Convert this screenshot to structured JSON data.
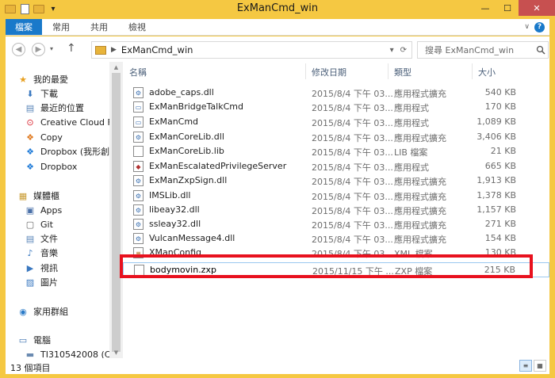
{
  "window": {
    "title": "ExManCmd_win",
    "min_label": "—",
    "max_label": "☐",
    "close_label": "✕"
  },
  "ribbon": {
    "tabs": [
      "檔案",
      "常用",
      "共用",
      "檢視"
    ]
  },
  "address": {
    "back_label": "◀",
    "forward_label": "▶",
    "up_label": "↑",
    "path": "ExManCmd_win",
    "sep": "▶",
    "refresh_label": "⟳",
    "dropdown_label": "▾"
  },
  "search": {
    "placeholder": "搜尋 ExManCmd_win"
  },
  "sidebar": {
    "items": [
      {
        "label": "我的最愛",
        "icon": "star-icon"
      },
      {
        "label": "下載",
        "icon": "download-icon"
      },
      {
        "label": "最近的位置",
        "icon": "recent-icon"
      },
      {
        "label": "Creative Cloud F",
        "icon": "creative-cloud-icon"
      },
      {
        "label": "Copy",
        "icon": "copy-icon"
      },
      {
        "label": "Dropbox (我形創",
        "icon": "dropbox-icon"
      },
      {
        "label": "Dropbox",
        "icon": "dropbox-icon"
      },
      {
        "label": "媒體櫃",
        "icon": "library-icon"
      },
      {
        "label": "Apps",
        "icon": "apps-icon"
      },
      {
        "label": "Git",
        "icon": "git-icon"
      },
      {
        "label": "文件",
        "icon": "documents-icon"
      },
      {
        "label": "音樂",
        "icon": "music-icon"
      },
      {
        "label": "視訊",
        "icon": "video-icon"
      },
      {
        "label": "圖片",
        "icon": "pictures-icon"
      },
      {
        "label": "家用群組",
        "icon": "homegroup-icon"
      },
      {
        "label": "電腦",
        "icon": "computer-icon"
      },
      {
        "label": "TI310542008 (C:",
        "icon": "drive-icon"
      }
    ]
  },
  "columns": {
    "name": "名稱",
    "date": "修改日期",
    "type": "類型",
    "size": "大小"
  },
  "files": [
    {
      "name": "adobe_caps.dll",
      "date": "2015/8/4 下午 03...",
      "type": "應用程式擴充",
      "size": "540 KB",
      "icon": "dll-file-icon"
    },
    {
      "name": "ExManBridgeTalkCmd",
      "date": "2015/8/4 下午 03...",
      "type": "應用程式",
      "size": "170 KB",
      "icon": "exe-file-icon"
    },
    {
      "name": "ExManCmd",
      "date": "2015/8/4 下午 03...",
      "type": "應用程式",
      "size": "1,089 KB",
      "icon": "exe-file-icon"
    },
    {
      "name": "ExManCoreLib.dll",
      "date": "2015/8/4 下午 03...",
      "type": "應用程式擴充",
      "size": "3,406 KB",
      "icon": "dll-file-icon"
    },
    {
      "name": "ExManCoreLib.lib",
      "date": "2015/8/4 下午 03...",
      "type": "LIB 檔案",
      "size": "21 KB",
      "icon": "lib-file-icon"
    },
    {
      "name": "ExManEscalatedPrivilegeServer",
      "date": "2015/8/4 下午 03...",
      "type": "應用程式",
      "size": "665 KB",
      "icon": "exe-file-icon"
    },
    {
      "name": "ExManZxpSign.dll",
      "date": "2015/8/4 下午 03...",
      "type": "應用程式擴充",
      "size": "1,913 KB",
      "icon": "dll-file-icon"
    },
    {
      "name": "IMSLib.dll",
      "date": "2015/8/4 下午 03...",
      "type": "應用程式擴充",
      "size": "1,378 KB",
      "icon": "dll-file-icon"
    },
    {
      "name": "libeay32.dll",
      "date": "2015/8/4 下午 03...",
      "type": "應用程式擴充",
      "size": "1,157 KB",
      "icon": "dll-file-icon"
    },
    {
      "name": "ssleay32.dll",
      "date": "2015/8/4 下午 03...",
      "type": "應用程式擴充",
      "size": "271 KB",
      "icon": "dll-file-icon"
    },
    {
      "name": "VulcanMessage4.dll",
      "date": "2015/8/4 下午 03...",
      "type": "應用程式擴充",
      "size": "154 KB",
      "icon": "dll-file-icon"
    },
    {
      "name": "XManConfig",
      "date": "2015/8/4 下午 03...",
      "type": "XML 檔案",
      "size": "130 KB",
      "icon": "xml-file-icon"
    },
    {
      "name": "bodymovin.zxp",
      "date": "2015/11/15 下午 ...",
      "type": "ZXP 檔案",
      "size": "215 KB",
      "icon": "zxp-file-icon"
    }
  ],
  "status": {
    "count": "13 個項目"
  },
  "colors": {
    "accent": "#1979ca",
    "highlight": "#e8111e",
    "title_bg": "#f5c842"
  }
}
